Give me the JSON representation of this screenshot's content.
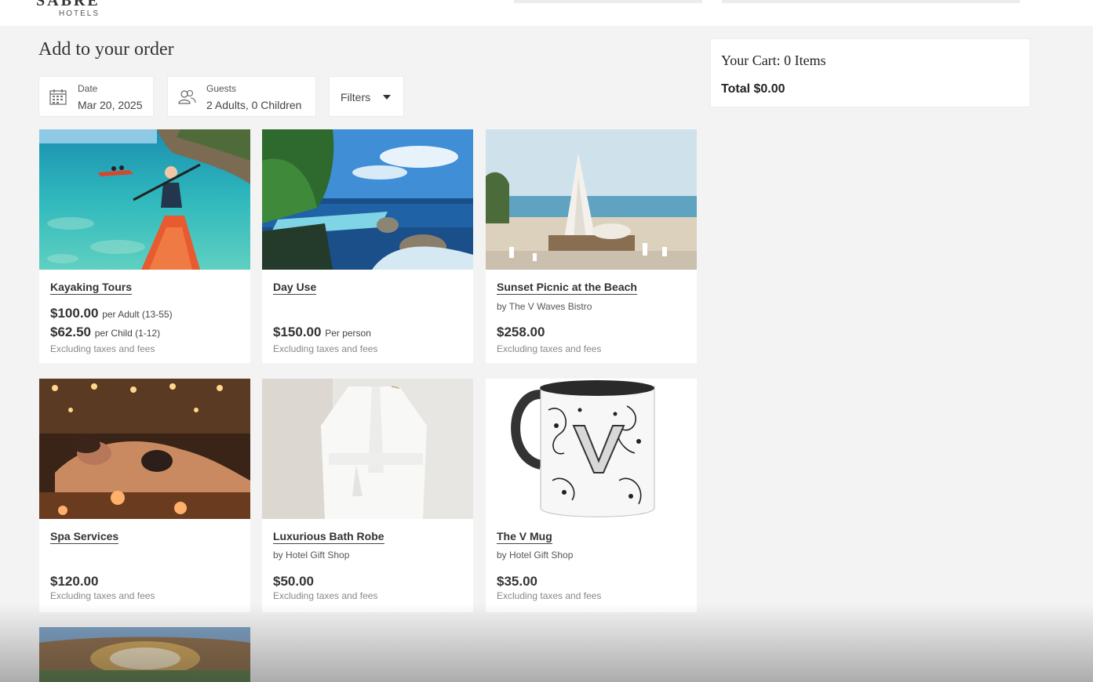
{
  "header": {
    "brand_name": "SABRE",
    "brand_sub": "HOTELS"
  },
  "page": {
    "title": "Add to your order"
  },
  "filters_bar": {
    "date_label": "Date",
    "date_value": "Mar 20, 2025",
    "guests_label": "Guests",
    "guests_value": "2 Adults, 0 Children",
    "filters_label": "Filters"
  },
  "cart": {
    "title": "Your Cart: 0 Items",
    "total": "Total $0.00"
  },
  "products": [
    {
      "title": "Kayaking Tours",
      "by": "",
      "price1": "$100.00",
      "unit1": "per Adult (13-55)",
      "price2": "$62.50",
      "unit2": "per Child (1-12)",
      "note": "Excluding taxes and fees"
    },
    {
      "title": "Day Use",
      "by": "",
      "price1": "$150.00",
      "unit1": "Per person",
      "note": "Excluding taxes and fees"
    },
    {
      "title": "Sunset Picnic at the Beach",
      "by": "by The V Waves Bistro",
      "price1": "$258.00",
      "unit1": "",
      "note": "Excluding taxes and fees"
    },
    {
      "title": "Spa Services",
      "by": "",
      "price1": "$120.00",
      "unit1": "",
      "note": "Excluding taxes and fees"
    },
    {
      "title": "Luxurious Bath Robe",
      "by": "by Hotel Gift Shop",
      "price1": "$50.00",
      "unit1": "",
      "note": "Excluding taxes and fees"
    },
    {
      "title": "The V Mug",
      "by": "by Hotel Gift Shop",
      "price1": "$35.00",
      "unit1": "",
      "note": "Excluding taxes and fees"
    }
  ],
  "icons": {
    "date": "calendar-icon",
    "guests": "people-icon",
    "filters": "caret-down-icon"
  }
}
